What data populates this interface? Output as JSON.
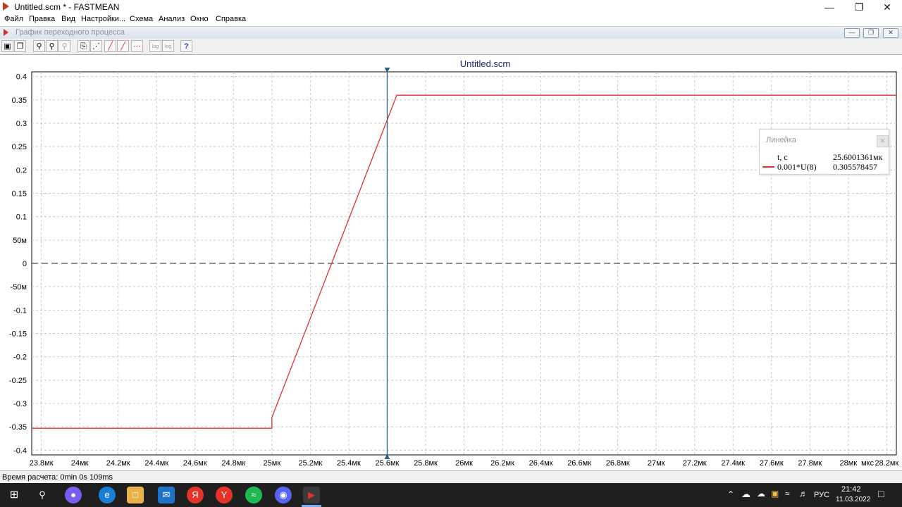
{
  "window": {
    "title": "Untitled.scm * - FASTMEAN"
  },
  "menu": [
    "Файл",
    "Правка",
    "Вид",
    "Настройки...",
    "Схема",
    "Анализ",
    "Окно",
    "Справка"
  ],
  "subwindow": {
    "title": "График переходного процесса"
  },
  "toolbar": {
    "log_label": "log",
    "help_label": "?"
  },
  "chart_data": {
    "type": "line",
    "title": "Untitled.scm",
    "xlim": [
      23.75,
      28.25
    ],
    "ylim": [
      -0.41,
      0.41
    ],
    "x_ticks": [
      23.8,
      24.0,
      24.2,
      24.4,
      24.6,
      24.8,
      25.0,
      25.2,
      25.4,
      25.6,
      25.8,
      26.0,
      26.2,
      26.4,
      26.6,
      26.8,
      27.0,
      27.2,
      27.4,
      27.6,
      27.8,
      28.0,
      28.2
    ],
    "x_tick_labels": [
      "23.8мк",
      "24мк",
      "24.2мк",
      "24.4мк",
      "24.6мк",
      "24.8мк",
      "25мк",
      "25.2мк",
      "25.4мк",
      "25.6мк",
      "25.8мк",
      "26мк",
      "26.2мк",
      "26.4мк",
      "26.6мк",
      "26.8мк",
      "27мк",
      "27.2мк",
      "27.4мк",
      "27.6мк",
      "27.8мк",
      "28мк",
      "28.2мк"
    ],
    "x_unit_label": "мкс",
    "y_ticks": [
      0.4,
      0.35,
      0.3,
      0.25,
      0.2,
      0.15,
      0.1,
      0.05,
      0,
      -0.05,
      -0.1,
      -0.15,
      -0.2,
      -0.25,
      -0.3,
      -0.35,
      -0.4
    ],
    "y_tick_labels": [
      "0.4",
      "0.35",
      "0.3",
      "0.25",
      "0.2",
      "0.15",
      "0.1",
      "50м",
      "0",
      "-50м",
      "-0.1",
      "-0.15",
      "-0.2",
      "-0.25",
      "-0.3",
      "-0.35",
      "-0.4"
    ],
    "grid": true,
    "series": [
      {
        "name": "0.001*U(8)",
        "color": "#e03030",
        "x": [
          23.75,
          25.0,
          25.0,
          25.65,
          28.25
        ],
        "y": [
          -0.353,
          -0.353,
          -0.33,
          0.36,
          0.36
        ]
      }
    ],
    "cursor_x": 25.6,
    "ruler": {
      "title": "Линейка",
      "t_label": "t, c",
      "t_value": "25.6001361мк",
      "series_label": "0.001*U(8)",
      "series_value": "0.305578457"
    }
  },
  "status": {
    "text": "Время расчета: 0min 0s 109ms"
  },
  "taskbar": {
    "lang": "РУС",
    "time": "21:42",
    "date": "11.03.2022",
    "apps": [
      "windows-start",
      "search",
      "cortana",
      "edge",
      "explorer",
      "mail",
      "yandex",
      "yandex-browser",
      "spotify",
      "discord",
      "fastmean"
    ]
  }
}
